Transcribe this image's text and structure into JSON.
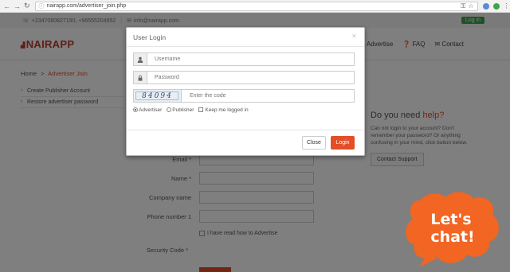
{
  "browser": {
    "url": "nairapp.com/advertiser_join.php"
  },
  "topbar": {
    "phone": "+2347080827190, +96555204852",
    "email": "info@nairapp.com",
    "login": "Log in"
  },
  "header": {
    "logo": "NAIRAPP",
    "nav": {
      "advertise": "o Advertise",
      "faq": "FAQ",
      "contact": "Contact"
    }
  },
  "breadcrumb": {
    "home": "Home",
    "sep": ">",
    "current": "Advertiser Join"
  },
  "sidemenu": {
    "items": [
      "Create Publisher Account",
      "Restore advertiser password"
    ]
  },
  "form": {
    "email_label": "Email *",
    "name_label": "Name *",
    "company_label": "Company name",
    "phone_label": "Phone number 1",
    "agree_label": "I have read how to Advertise",
    "security_label": "Security Code *"
  },
  "help": {
    "title_a": "Do you need ",
    "title_b": "help?",
    "text": "Can not login to your account? Don't remember your password? Or anything confusing in your mind, click button below.",
    "button": "Contact Support"
  },
  "modal": {
    "title": "User Login",
    "close_x": "×",
    "username_placeholder": "Username",
    "password_placeholder": "Password",
    "captcha_code": "84094",
    "captcha_placeholder": "Enter the code",
    "radio_advertiser": "Advertiser",
    "radio_publisher": "Publisher",
    "keep_logged": "Keep me logged in",
    "close_button": "Close",
    "login_button": "Login"
  },
  "chat": {
    "line1": "Let's",
    "line2": "chat!"
  },
  "colors": {
    "accent": "#e44d26",
    "chat_orange": "#f26522",
    "green": "#3fa34d"
  }
}
